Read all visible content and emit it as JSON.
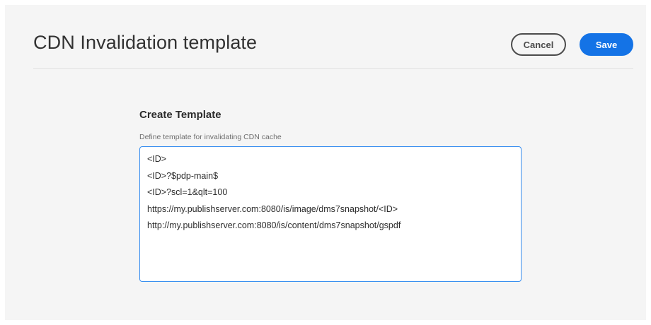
{
  "header": {
    "title": "CDN Invalidation template",
    "cancel_label": "Cancel",
    "save_label": "Save"
  },
  "form": {
    "section_title": "Create Template",
    "field_label": "Define template for invalidating CDN cache",
    "template_value": "<ID>\n<ID>?$pdp-main$\n<ID>?scl=1&qlt=100\nhttps://my.publishserver.com:8080/is/image/dms7snapshot/<ID>\nhttp://my.publishserver.com:8080/is/content/dms7snapshot/gspdf"
  },
  "colors": {
    "accent": "#1473e6",
    "focus_border": "#378ef0",
    "background": "#f5f5f5"
  }
}
